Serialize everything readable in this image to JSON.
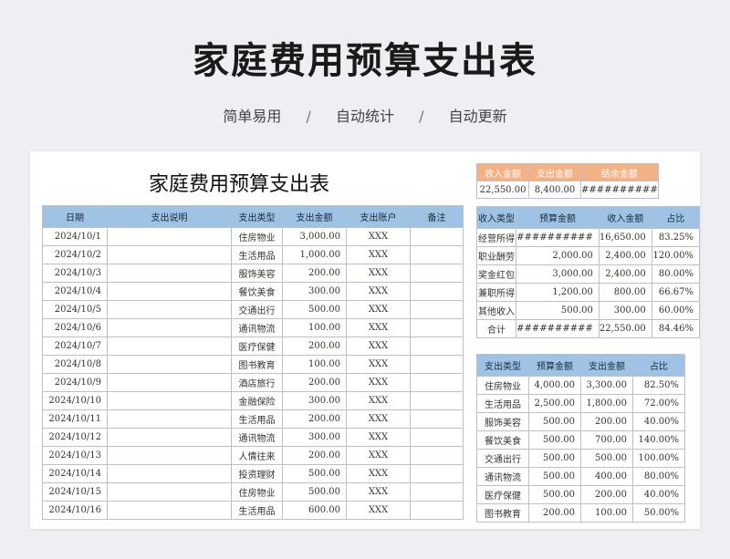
{
  "header": {
    "title": "家庭费用预算支出表",
    "subtitle": [
      "简单易用",
      "自动统计",
      "自动更新"
    ],
    "separator": "/"
  },
  "sheet": {
    "title": "家庭费用预算支出表",
    "main_table": {
      "columns": [
        "日期",
        "支出说明",
        "支出类型",
        "支出金额",
        "支出账户",
        "备注"
      ],
      "rows": [
        [
          "2024/10/1",
          "",
          "住房物业",
          "3,000.00",
          "XXX",
          ""
        ],
        [
          "2024/10/2",
          "",
          "生活用品",
          "1,000.00",
          "XXX",
          ""
        ],
        [
          "2024/10/3",
          "",
          "服饰美容",
          "200.00",
          "XXX",
          ""
        ],
        [
          "2024/10/4",
          "",
          "餐饮美食",
          "300.00",
          "XXX",
          ""
        ],
        [
          "2024/10/5",
          "",
          "交通出行",
          "500.00",
          "XXX",
          ""
        ],
        [
          "2024/10/6",
          "",
          "通讯物流",
          "100.00",
          "XXX",
          ""
        ],
        [
          "2024/10/7",
          "",
          "医疗保健",
          "200.00",
          "XXX",
          ""
        ],
        [
          "2024/10/8",
          "",
          "图书教育",
          "100.00",
          "XXX",
          ""
        ],
        [
          "2024/10/9",
          "",
          "酒店旅行",
          "200.00",
          "XXX",
          ""
        ],
        [
          "2024/10/10",
          "",
          "金融保险",
          "300.00",
          "XXX",
          ""
        ],
        [
          "2024/10/11",
          "",
          "生活用品",
          "200.00",
          "XXX",
          ""
        ],
        [
          "2024/10/12",
          "",
          "通讯物流",
          "300.00",
          "XXX",
          ""
        ],
        [
          "2024/10/13",
          "",
          "人情往来",
          "200.00",
          "XXX",
          ""
        ],
        [
          "2024/10/14",
          "",
          "投资理财",
          "500.00",
          "XXX",
          ""
        ],
        [
          "2024/10/15",
          "",
          "住房物业",
          "500.00",
          "XXX",
          ""
        ],
        [
          "2024/10/16",
          "",
          "生活用品",
          "600.00",
          "XXX",
          ""
        ]
      ]
    },
    "summary": {
      "columns": [
        "收入金额",
        "支出金额",
        "结余金额"
      ],
      "values": [
        "22,550.00",
        "8,400.00",
        "##########"
      ]
    },
    "income_table": {
      "columns": [
        "收入类型",
        "预算金额",
        "收入金额",
        "占比"
      ],
      "rows": [
        [
          "经营所得",
          "##########",
          "16,650.00",
          "83.25%"
        ],
        [
          "职业酬劳",
          "2,000.00",
          "2,400.00",
          "120.00%"
        ],
        [
          "奖金红包",
          "3,000.00",
          "2,400.00",
          "80.00%"
        ],
        [
          "兼职所得",
          "1,200.00",
          "800.00",
          "66.67%"
        ],
        [
          "其他收入",
          "500.00",
          "300.00",
          "60.00%"
        ],
        [
          "合计",
          "##########",
          "22,550.00",
          "84.46%"
        ]
      ]
    },
    "expense_table": {
      "columns": [
        "支出类型",
        "预算金额",
        "支出金额",
        "占比"
      ],
      "rows": [
        [
          "住房物业",
          "4,000.00",
          "3,300.00",
          "82.50%"
        ],
        [
          "生活用品",
          "2,500.00",
          "1,800.00",
          "72.00%"
        ],
        [
          "服饰美容",
          "500.00",
          "200.00",
          "40.00%"
        ],
        [
          "餐饮美食",
          "500.00",
          "700.00",
          "140.00%"
        ],
        [
          "交通出行",
          "500.00",
          "500.00",
          "100.00%"
        ],
        [
          "通讯物流",
          "500.00",
          "400.00",
          "80.00%"
        ],
        [
          "医疗保健",
          "500.00",
          "200.00",
          "40.00%"
        ],
        [
          "图书教育",
          "200.00",
          "100.00",
          "50.00%"
        ]
      ]
    }
  },
  "colors": {
    "page_bg": "#edeff2",
    "header_blue": "#9fc3e4",
    "header_orange": "#f4b183",
    "grid": "#b9c1cc"
  }
}
